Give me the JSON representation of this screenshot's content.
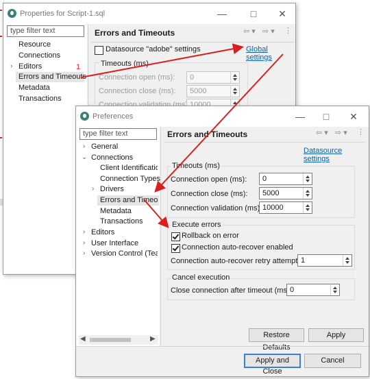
{
  "back_dialog": {
    "title": "Properties for Script-1.sql",
    "filter_placeholder": "type filter text",
    "tree": [
      "Resource",
      "Connections",
      "Editors",
      "Errors and Timeouts",
      "Metadata",
      "Transactions"
    ],
    "selected_index": 3,
    "annotation_number": "1",
    "header": "Errors and Timeouts",
    "datasource_checkbox_label": "Datasource \"adobe\" settings",
    "global_settings_link": "Global settings",
    "timeouts_group": "Timeouts (ms)",
    "rows": [
      {
        "label": "Connection open (ms):",
        "value": "0"
      },
      {
        "label": "Connection close (ms):",
        "value": "5000"
      },
      {
        "label": "Connection validation (ms):",
        "value": "10000"
      }
    ]
  },
  "prefs_dialog": {
    "title": "Preferences",
    "filter_placeholder": "type filter text",
    "tree": [
      {
        "label": "General",
        "indent": 1,
        "chevron": "collapsed"
      },
      {
        "label": "Connections",
        "indent": 1,
        "chevron": "expanded"
      },
      {
        "label": "Client Identification",
        "indent": 2,
        "chevron": ""
      },
      {
        "label": "Connection Types",
        "indent": 2,
        "chevron": ""
      },
      {
        "label": "Drivers",
        "indent": 2,
        "chevron": "collapsed"
      },
      {
        "label": "Errors and Timeouts",
        "indent": 2,
        "chevron": "",
        "selected": true
      },
      {
        "label": "Metadata",
        "indent": 2,
        "chevron": ""
      },
      {
        "label": "Transactions",
        "indent": 2,
        "chevron": ""
      },
      {
        "label": "Editors",
        "indent": 1,
        "chevron": "collapsed"
      },
      {
        "label": "User Interface",
        "indent": 1,
        "chevron": "collapsed"
      },
      {
        "label": "Version Control (Team)",
        "indent": 1,
        "chevron": "collapsed"
      }
    ],
    "header": "Errors and Timeouts",
    "datasource_settings_link": "Datasource settings",
    "timeouts_group": "Timeouts (ms)",
    "timeouts": [
      {
        "label": "Connection open (ms):",
        "value": "0"
      },
      {
        "label": "Connection close (ms):",
        "value": "5000"
      },
      {
        "label": "Connection validation (ms):",
        "value": "10000"
      }
    ],
    "execute_errors_group": "Execute errors",
    "rollback_label": "Rollback on error",
    "rollback_checked": true,
    "auto_recover_label": "Connection auto-recover enabled",
    "auto_recover_checked": true,
    "retry_label": "Connection auto-recover retry attempts:",
    "retry_value": "1",
    "cancel_group": "Cancel execution",
    "close_after_timeout_label": "Close connection after timeout (ms):",
    "close_after_timeout_value": "0",
    "restore_defaults": "Restore Defaults",
    "apply": "Apply",
    "apply_and_close": "Apply and Close",
    "cancel": "Cancel"
  },
  "colors": {
    "annotation_red": "#d92020",
    "link_blue": "#0a5fb4",
    "selection": "#cce4f7"
  }
}
